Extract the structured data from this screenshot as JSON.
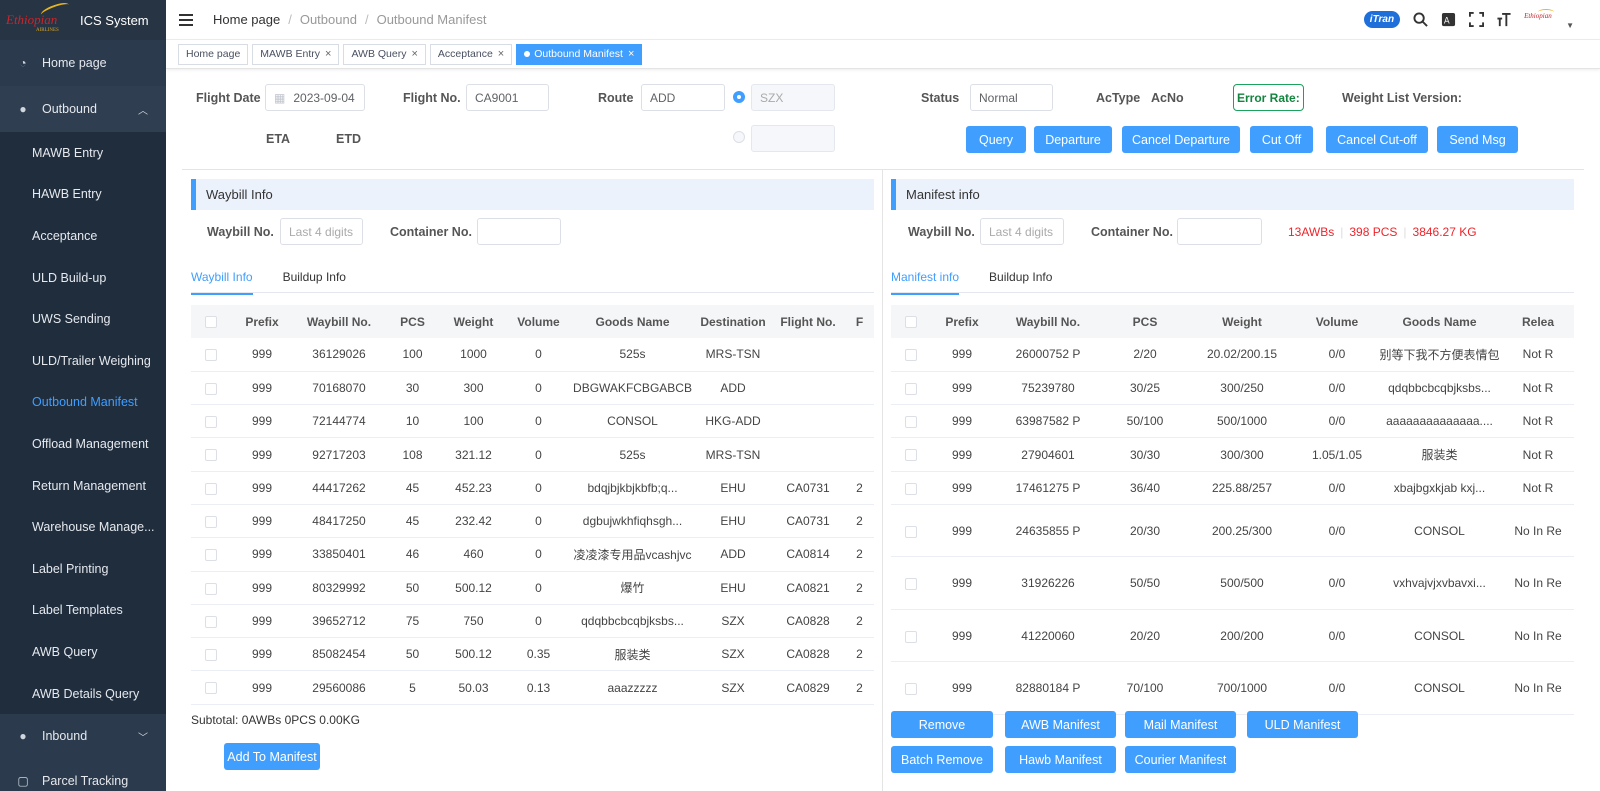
{
  "app": {
    "title": "ICS System",
    "logo_text": "Ethiopian"
  },
  "sidebar": {
    "home": "Home page",
    "outbound": "Outbound",
    "items": [
      "MAWB Entry",
      "HAWB Entry",
      "Acceptance",
      "ULD Build-up",
      "UWS Sending",
      "ULD/Trailer Weighing",
      "Outbound Manifest",
      "Offload Management",
      "Return Management",
      "Warehouse Manage...",
      "Label Printing",
      "Label Templates",
      "AWB Query",
      "AWB Details Query"
    ],
    "active_index": 6,
    "inbound": "Inbound",
    "parcel": "Parcel Tracking"
  },
  "breadcrumb": [
    "Home page",
    "Outbound",
    "Outbound Manifest"
  ],
  "topbar": {
    "itran": "iTran"
  },
  "tabs": [
    "Home page",
    "MAWB Entry",
    "AWB Query",
    "Acceptance",
    "Outbound Manifest"
  ],
  "form": {
    "flight_date_label": "Flight Date",
    "flight_date": "2023-09-04",
    "flight_no_label": "Flight No.",
    "flight_no": "CA9001",
    "route_label": "Route",
    "route_from": "ADD",
    "route_to": "SZX",
    "status_label": "Status",
    "status": "Normal",
    "actype_label": "AcType",
    "acno_label": "AcNo",
    "error_rate_label": "Error Rate:",
    "weight_list_label": "Weight List Version:",
    "eta_label": "ETA",
    "etd_label": "ETD"
  },
  "actions": [
    "Query",
    "Departure",
    "Cancel Departure",
    "Cut Off",
    "Cancel Cut-off",
    "Send Msg"
  ],
  "waybill": {
    "title": "Waybill Info",
    "waybill_no_label": "Waybill No.",
    "waybill_placeholder": "Last 4 digits",
    "container_label": "Container No.",
    "tabs": [
      "Waybill Info",
      "Buildup Info"
    ],
    "columns": [
      "Prefix",
      "Waybill No.",
      "PCS",
      "Weight",
      "Volume",
      "Goods Name",
      "Destination",
      "Flight No.",
      "F"
    ],
    "rows": [
      [
        "999",
        "36129026",
        "100",
        "1000",
        "0",
        "525s",
        "MRS-TSN",
        "",
        ""
      ],
      [
        "999",
        "70168070",
        "30",
        "300",
        "0",
        "DBGWAKFCBGABCB",
        "ADD",
        "",
        ""
      ],
      [
        "999",
        "72144774",
        "10",
        "100",
        "0",
        "CONSOL",
        "HKG-ADD",
        "",
        ""
      ],
      [
        "999",
        "92717203",
        "108",
        "321.12",
        "0",
        "525s",
        "MRS-TSN",
        "",
        ""
      ],
      [
        "999",
        "44417262",
        "45",
        "452.23",
        "0",
        "bdqjbjkbjkbfb;q...",
        "EHU",
        "CA0731",
        "2"
      ],
      [
        "999",
        "48417250",
        "45",
        "232.42",
        "0",
        "dgbujwkhfiqhsgh...",
        "EHU",
        "CA0731",
        "2"
      ],
      [
        "999",
        "33850401",
        "46",
        "460",
        "0",
        "凌凌漆专用品vcashjvc",
        "ADD",
        "CA0814",
        "2"
      ],
      [
        "999",
        "80329992",
        "50",
        "500.12",
        "0",
        "爆竹",
        "EHU",
        "CA0821",
        "2"
      ],
      [
        "999",
        "39652712",
        "75",
        "750",
        "0",
        "qdqbbcbcqbjksbs...",
        "SZX",
        "CA0828",
        "2"
      ],
      [
        "999",
        "85082454",
        "50",
        "500.12",
        "0.35",
        "服装类",
        "SZX",
        "CA0828",
        "2"
      ],
      [
        "999",
        "29560086",
        "5",
        "50.03",
        "0.13",
        "aaazzzzz",
        "SZX",
        "CA0829",
        "2"
      ]
    ],
    "subtotal": "Subtotal: 0AWBs 0PCS 0.00KG",
    "add_button": "Add To Manifest"
  },
  "manifest": {
    "title": "Manifest info",
    "waybill_no_label": "Waybill No.",
    "waybill_placeholder": "Last 4 digits",
    "container_label": "Container No.",
    "awbs": "13AWBs",
    "pcs": "398 PCS",
    "kg": "3846.27 KG",
    "tabs": [
      "Manifest info",
      "Buildup Info"
    ],
    "columns": [
      "Prefix",
      "Waybill No.",
      "PCS",
      "Weight",
      "Volume",
      "Goods Name",
      "Relea"
    ],
    "rows": [
      [
        "999",
        "26000752 P",
        "2/20",
        "20.02/200.15",
        "0/0",
        "别等下我不方便表情包",
        "Not R"
      ],
      [
        "999",
        "75239780",
        "30/25",
        "300/250",
        "0/0",
        "qdqbbcbcqbjksbs...",
        "Not R"
      ],
      [
        "999",
        "63987582 P",
        "50/100",
        "500/1000",
        "0/0",
        "aaaaaaaaaaaaaa....",
        "Not R"
      ],
      [
        "999",
        "27904601",
        "30/30",
        "300/300",
        "1.05/1.05",
        "服装类",
        "Not R"
      ],
      [
        "999",
        "17461275 P",
        "36/40",
        "225.88/257",
        "0/0",
        "xbajbgxkjab kxj...",
        "Not R"
      ],
      [
        "999",
        "24635855 P",
        "20/30",
        "200.25/300",
        "0/0",
        "CONSOL",
        "No In Re"
      ],
      [
        "999",
        "31926226",
        "50/50",
        "500/500",
        "0/0",
        "vxhvajvjxvbavxi...",
        "No In Re"
      ],
      [
        "999",
        "41220060",
        "20/20",
        "200/200",
        "0/0",
        "CONSOL",
        "No In Re"
      ],
      [
        "999",
        "82880184 P",
        "70/100",
        "700/1000",
        "0/0",
        "CONSOL",
        "No In Re"
      ]
    ],
    "buttons_row1": [
      "Remove",
      "AWB Manifest",
      "Mail Manifest",
      "ULD Manifest"
    ],
    "buttons_row2": [
      "Batch Remove",
      "Hawb Manifest",
      "Courier Manifest"
    ]
  }
}
